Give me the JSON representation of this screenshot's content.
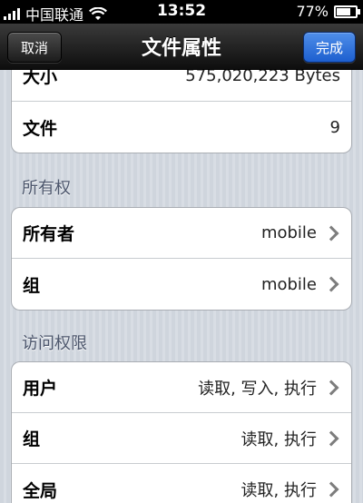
{
  "status": {
    "carrier": "中国联通",
    "time": "13:52",
    "battery": "77%",
    "battery_level": 0.77
  },
  "nav": {
    "title": "文件属性",
    "cancel": "取消",
    "done": "完成"
  },
  "info_rows": [
    {
      "label": "大小",
      "value": "575,020,223 Bytes"
    },
    {
      "label": "文件",
      "value": "9"
    }
  ],
  "sections": {
    "ownership": {
      "title": "所有权",
      "rows": [
        {
          "label": "所有者",
          "value": "mobile"
        },
        {
          "label": "组",
          "value": "mobile"
        }
      ]
    },
    "permissions": {
      "title": "访问权限",
      "rows": [
        {
          "label": "用户",
          "value": "读取, 写入, 执行"
        },
        {
          "label": "组",
          "value": "读取, 执行"
        },
        {
          "label": "全局",
          "value": "读取, 执行"
        }
      ]
    }
  }
}
